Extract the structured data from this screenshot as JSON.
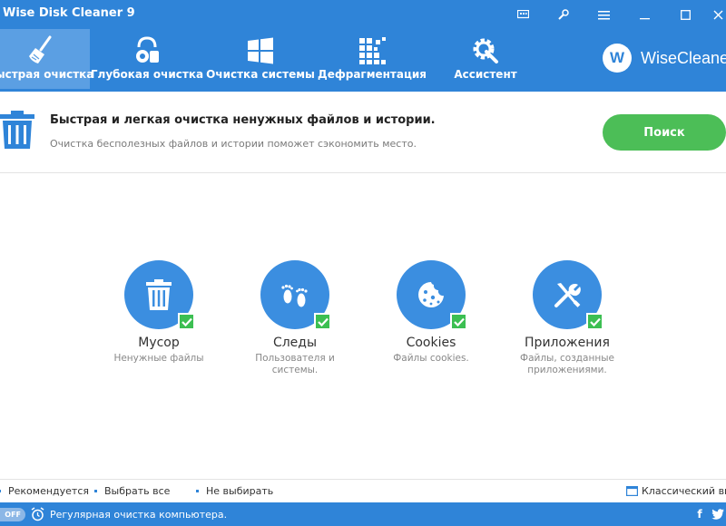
{
  "window": {
    "title": "Wise Disk Cleaner 9"
  },
  "toolbar": {
    "items": [
      {
        "label": "Быстрая очистка",
        "icon": "broom-icon",
        "active": true
      },
      {
        "label": "Глубокая очистка",
        "icon": "vacuum-icon",
        "active": false
      },
      {
        "label": "Очистка системы",
        "icon": "windows-icon",
        "active": false
      },
      {
        "label": "Дефрагментация",
        "icon": "defrag-blocks-icon",
        "active": false
      },
      {
        "label": "Ассистент",
        "icon": "gear-wrench-icon",
        "active": false
      }
    ],
    "brand": "WiseCleaner",
    "brand_logo_letter": "W"
  },
  "banner": {
    "title": "Быстрая и легкая очистка ненужных файлов и истории.",
    "subtitle": "Очистка бесполезных файлов и истории поможет сэкономить место.",
    "scan_label": "Поиск"
  },
  "categories": [
    {
      "title": "Мусор",
      "subtitle": "Ненужные файлы",
      "icon": "trash-icon",
      "checked": true
    },
    {
      "title": "Следы",
      "subtitle": "Пользователя и системы.",
      "icon": "footprints-icon",
      "checked": true
    },
    {
      "title": "Cookies",
      "subtitle": "Файлы cookies.",
      "icon": "cookie-icon",
      "checked": true
    },
    {
      "title": "Приложения",
      "subtitle": "Файлы, созданные приложениями.",
      "icon": "tools-icon",
      "checked": true
    }
  ],
  "links": {
    "recommended": "Рекомендуется",
    "select_all": "Выбрать все",
    "select_none": "Не выбирать",
    "classic_view": "Классический вид"
  },
  "status": {
    "toggle": "OFF",
    "text": "Регулярная очистка компьютера.",
    "facebook": "f"
  },
  "colors": {
    "header_blue": "#2f84d8",
    "active_tab": "#5b9fe3",
    "scan_green": "#4cbe57",
    "check_green": "#3cbf52",
    "circle_blue": "#3b8ee0"
  }
}
